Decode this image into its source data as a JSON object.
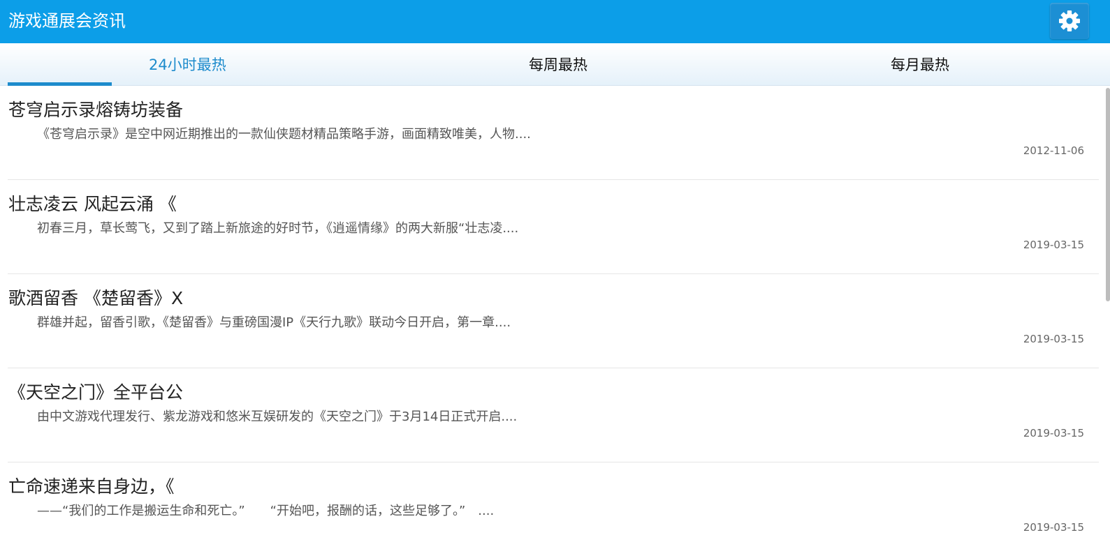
{
  "app": {
    "title": "游戏通展会资讯",
    "settings_icon": "gear-icon"
  },
  "colors": {
    "header_bg": "#0c9ee8",
    "active_tab": "#1d8bcc",
    "settings_button_bg": "#1c8fd4"
  },
  "tabs": [
    {
      "label": "24小时最热",
      "active": true
    },
    {
      "label": "每周最热",
      "active": false
    },
    {
      "label": "每月最热",
      "active": false
    }
  ],
  "news": [
    {
      "title": "苍穹启示录熔铸坊装备",
      "summary": "《苍穹启示录》是空中网近期推出的一款仙侠题材精品策略手游，画面精致唯美，人物....",
      "date": "2012-11-06"
    },
    {
      "title": "壮志凌云 风起云涌 《",
      "summary": "初春三月，草长莺飞，又到了踏上新旅途的好时节，《逍遥情缘》的两大新服“壮志凌....",
      "date": "2019-03-15"
    },
    {
      "title": "歌酒留香 《楚留香》X",
      "summary": "群雄并起，留香引歌，《楚留香》与重磅国漫IP《天行九歌》联动今日开启，第一章....",
      "date": "2019-03-15"
    },
    {
      "title": "《天空之门》全平台公",
      "summary": "由中文游戏代理发行、紫龙游戏和悠米互娱研发的《天空之门》于3月14日正式开启....",
      "date": "2019-03-15"
    },
    {
      "title": "亡命速递来自身边，《",
      "summary": "——“我们的工作是搬运生命和死亡。”　　“开始吧，报酬的话，这些足够了。”　....",
      "date": "2019-03-15"
    }
  ]
}
